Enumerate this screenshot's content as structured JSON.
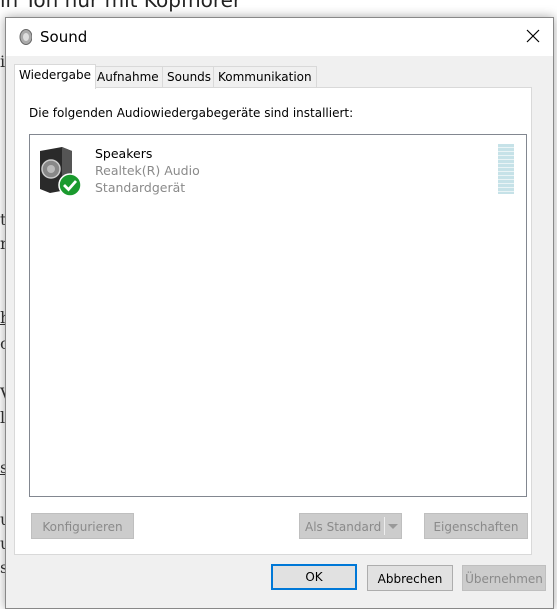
{
  "background": {
    "heading": "in Ton nur mit Kopfhörer",
    "left_fragments": [
      "il",
      "t",
      "n",
      "h",
      "c",
      "V",
      "le",
      "s",
      "u",
      "u",
      "s"
    ]
  },
  "dialog": {
    "title": "Sound",
    "icon": "speaker-icon",
    "tabs": [
      {
        "label": "Wiedergabe",
        "active": true
      },
      {
        "label": "Aufnahme"
      },
      {
        "label": "Sounds"
      },
      {
        "label": "Kommunikation"
      }
    ],
    "instruction": "Die folgenden Audiowiedergabegeräte sind installiert:",
    "devices": [
      {
        "name": "Speakers",
        "driver": "Realtek(R) Audio",
        "status": "Standardgerät",
        "icon": "speaker-device-icon",
        "badge": "green-check-icon",
        "level": 0
      }
    ],
    "buttons": {
      "configure": "Konfigurieren",
      "set_default": "Als Standard",
      "properties": "Eigenschaften",
      "ok": "OK",
      "cancel": "Abbrechen",
      "apply": "Übernehmen"
    },
    "accent": "#0078d7"
  }
}
